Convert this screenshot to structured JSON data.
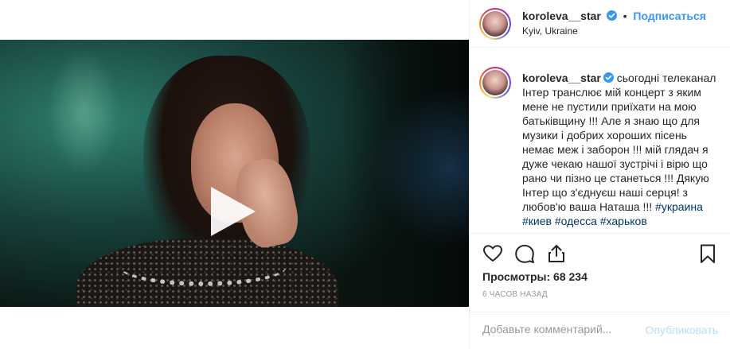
{
  "post": {
    "username": "koroleva__star",
    "follow_label": "Подписаться",
    "separator": "•",
    "location": "Kyiv, Ukraine",
    "caption_text": "сьогодні телеканал Інтер транслює мій концерт з яким мене не пустили приїхати на мою батьківщину !!! Але я знаю що для музики і добрих хороших пісень немає меж і заборон !!! мій глядач я дуже чекаю нашої зустрічі і вірю що рано чи пізно це станеться !!! Дякую Інтер що з'єднуєш наші серця! з любов'ю ваша Наташа !!! ",
    "hashtags": [
      "#украина",
      "#киев",
      "#одесса",
      "#харьков"
    ],
    "views_label": "Просмотры: 68 234",
    "timestamp": "6 часов назад",
    "comment_placeholder": "Добавьте комментарий...",
    "publish_label": "Опубликовать"
  },
  "colors": {
    "accent_link": "#3897f0",
    "hashtag": "#003569",
    "verified": "#3897f0",
    "publish_disabled": "#b2dffc"
  },
  "icons": {
    "header": [
      "verified-badge-icon"
    ],
    "media": [
      "play-icon",
      "user-tag-icon",
      "sound-icon"
    ],
    "actions": [
      "heart-icon",
      "comment-icon",
      "share-icon",
      "bookmark-icon"
    ]
  }
}
